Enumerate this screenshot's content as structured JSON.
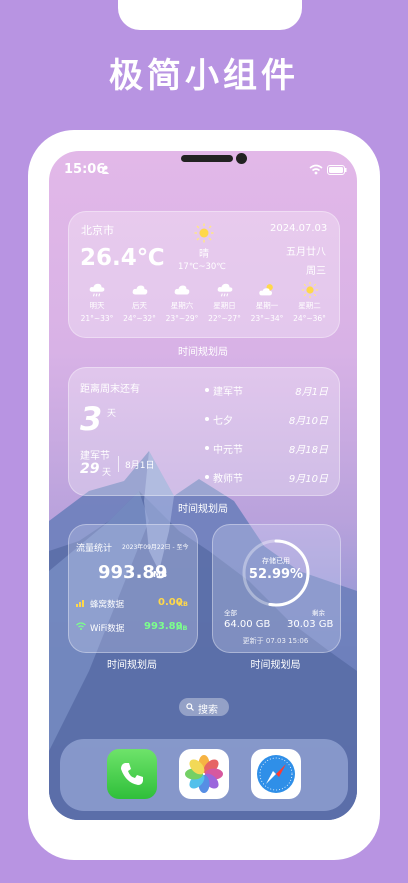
{
  "promo_title": "极简小组件",
  "status_bar": {
    "time": "15:06"
  },
  "weather": {
    "city": "北京市",
    "temp": "26.4℃",
    "condition": "晴",
    "range": "17℃~30℃",
    "date": "2024.07.03",
    "lunar": "五月廿八",
    "weekday": "周三",
    "forecast": [
      {
        "day": "明天",
        "range": "21°~33°",
        "icon": "rain-icon"
      },
      {
        "day": "后天",
        "range": "24°~32°",
        "icon": "cloud-icon"
      },
      {
        "day": "星期六",
        "range": "23°~29°",
        "icon": "cloud-icon"
      },
      {
        "day": "星期日",
        "range": "22°~27°",
        "icon": "rain-icon"
      },
      {
        "day": "星期一",
        "range": "23°~34°",
        "icon": "partly-cloudy-icon"
      },
      {
        "day": "星期二",
        "range": "24°~36°",
        "icon": "sun-icon"
      }
    ]
  },
  "countdown": {
    "label": "距离周末还有",
    "days": "3",
    "unit": "天",
    "sub_name": "建军节",
    "sub_days": "29",
    "sub_unit": "天",
    "sub_date": "8月1日",
    "list": [
      {
        "name": "建军节",
        "date": "8月1日"
      },
      {
        "name": "七夕",
        "date": "8月10日"
      },
      {
        "name": "中元节",
        "date": "8月18日"
      },
      {
        "name": "教师节",
        "date": "9月10日"
      }
    ]
  },
  "traffic": {
    "title": "流量统计",
    "period": "2023年09月22日 - 至今",
    "total": "993.89",
    "total_unit": "MB",
    "cell_label": "蜂窝数据",
    "cell_value": "0.00",
    "cell_unit": "KB",
    "wifi_label": "WiFi数据",
    "wifi_value": "993.89",
    "wifi_unit": "MB"
  },
  "storage": {
    "used_label": "存储已用",
    "percent": "52.99%",
    "percent_value": 52.99,
    "total_label": "全部",
    "remain_label": "剩余",
    "total": "64.00 GB",
    "remain": "30.03 GB",
    "updated": "更新于 07.03 15:06"
  },
  "widget_caption": "时间规划局",
  "search_label": "搜索",
  "dock_apps": [
    "phone-icon",
    "photos-icon",
    "safari-icon"
  ],
  "colors": {
    "accent_yellow": "#ffd84a",
    "accent_green": "#7cff8c",
    "background": "#b894e2"
  }
}
